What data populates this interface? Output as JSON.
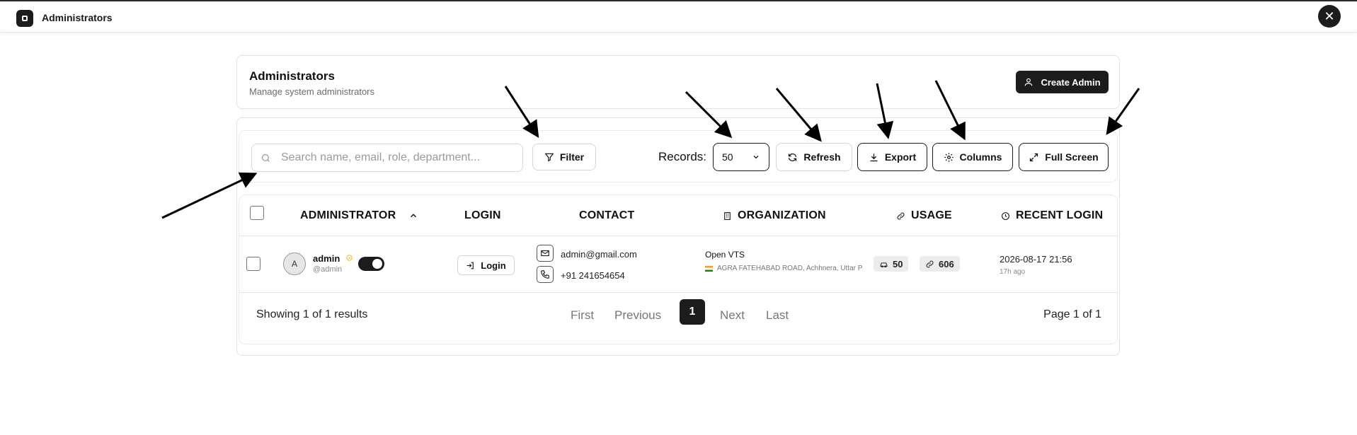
{
  "window": {
    "title": "Administrators"
  },
  "header": {
    "title": "Administrators",
    "subtitle": "Manage system administrators",
    "create_label": "Create Admin"
  },
  "toolbar": {
    "search_placeholder": "Search name, email, role, department...",
    "filter_label": "Filter",
    "records_label": "Records:",
    "records_value": "50",
    "refresh_label": "Refresh",
    "export_label": "Export",
    "columns_label": "Columns",
    "fullscreen_label": "Full Screen"
  },
  "table": {
    "columns": [
      "ADMINISTRATOR",
      "LOGIN",
      "CONTACT",
      "ORGANIZATION",
      "USAGE",
      "RECENT LOGIN"
    ],
    "rows": [
      {
        "avatar": "A",
        "name": "admin",
        "handle": "@admin",
        "login_label": "Login",
        "email": "admin@gmail.com",
        "phone": "+91 241654654",
        "org_name": "Open VTS",
        "org_address": "AGRA FATEHABAD ROAD, Achhnera, Uttar P",
        "usage_vehicles": "50",
        "usage_links": "606",
        "recent_time": "2026-08-17 21:56",
        "recent_ago": "17h ago"
      }
    ]
  },
  "footer": {
    "showing": "Showing 1 of 1 results",
    "first": "First",
    "previous": "Previous",
    "current": "1",
    "next": "Next",
    "last": "Last",
    "page_info": "Page 1 of 1"
  },
  "colors": {
    "accent": "#1c1c1c",
    "border": "#e3e3e3",
    "muted": "#777777"
  }
}
